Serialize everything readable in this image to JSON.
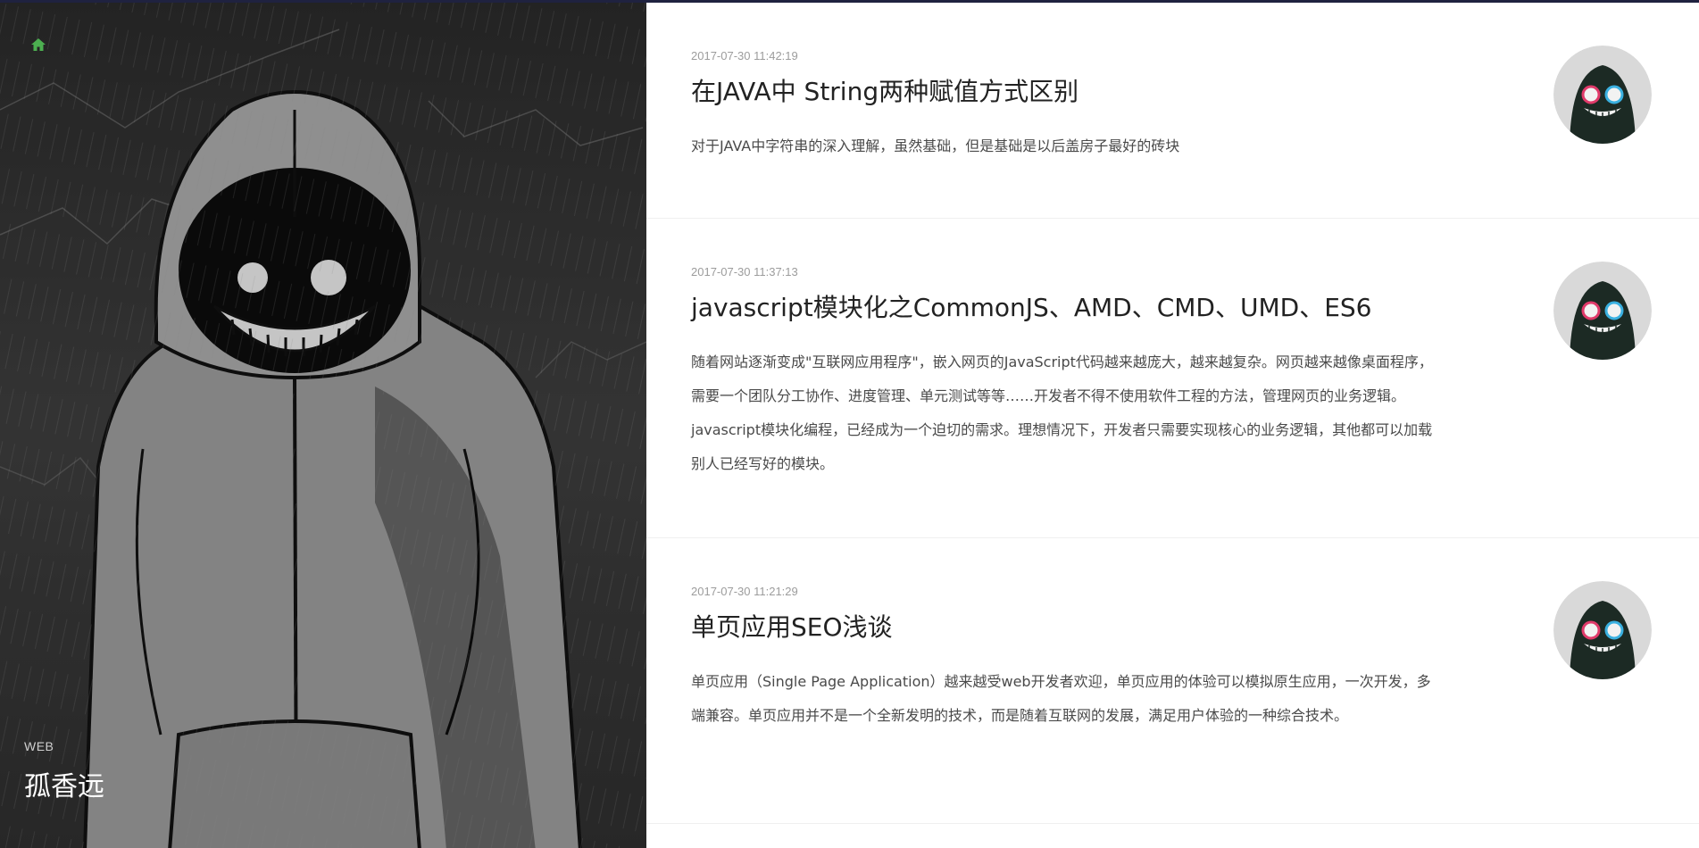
{
  "hero": {
    "subtitle": "WEB",
    "title": "孤香远",
    "home_icon": "home-icon",
    "accent_color": "#4caf50"
  },
  "posts": [
    {
      "date": "2017-07-30 11:42:19",
      "title": "在JAVA中 String两种赋值方式区别",
      "excerpt": "对于JAVA中字符串的深入理解，虽然基础，但是基础是以后盖房子最好的砖块",
      "avatar": "smiley-glitch-avatar"
    },
    {
      "date": "2017-07-30 11:37:13",
      "title": "javascript模块化之CommonJS、AMD、CMD、UMD、ES6",
      "excerpt": "随着网站逐渐变成\"互联网应用程序\"，嵌入网页的JavaScript代码越来越庞大，越来越复杂。网页越来越像桌面程序，需要一个团队分工协作、进度管理、单元测试等等……开发者不得不使用软件工程的方法，管理网页的业务逻辑。javascript模块化编程，已经成为一个迫切的需求。理想情况下，开发者只需要实现核心的业务逻辑，其他都可以加载别人已经写好的模块。",
      "avatar": "smiley-glitch-avatar"
    },
    {
      "date": "2017-07-30 11:21:29",
      "title": "单页应用SEO浅谈",
      "excerpt": "单页应用（Single Page Application）越来越受web开发者欢迎，单页应用的体验可以模拟原生应用，一次开发，多端兼容。单页应用并不是一个全新发明的技术，而是随着互联网的发展，满足用户体验的一种综合技术。",
      "avatar": "smiley-glitch-avatar"
    }
  ]
}
